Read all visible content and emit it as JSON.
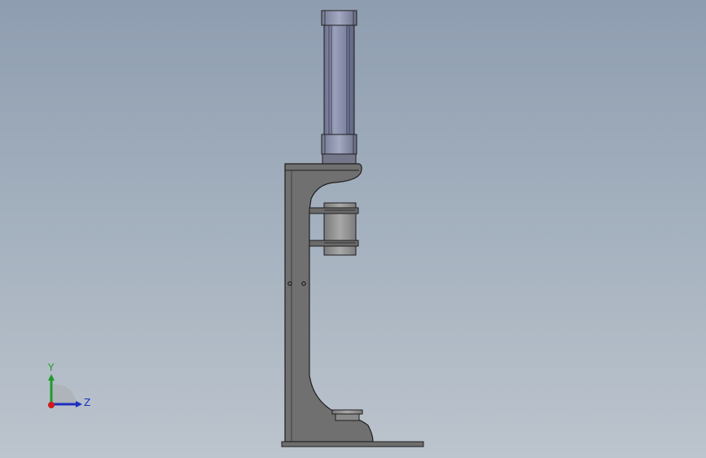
{
  "viewport": {
    "background_top": "#8e9db0",
    "background_bottom": "#bcc4cd"
  },
  "model": {
    "frame_color": "#6f6f6f",
    "frame_stroke": "#1e1e1e",
    "cylinder_color": "#8a8fa8",
    "cylinder_dark": "#5f6480",
    "collar_color": "#9a9a9a"
  },
  "triad": {
    "y_label": "Y",
    "z_label": "Z",
    "y_color": "#1f9a2a",
    "z_color": "#1c2fbf",
    "x_color": "#d11a1a"
  }
}
